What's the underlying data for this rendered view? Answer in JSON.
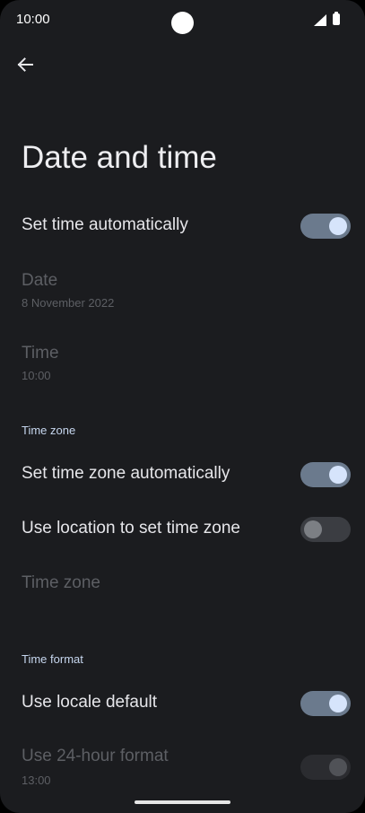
{
  "status_bar": {
    "time": "10:00"
  },
  "header": {
    "title": "Date and time"
  },
  "settings": {
    "set_time_automatically": {
      "label": "Set time automatically",
      "enabled": true
    },
    "date": {
      "label": "Date",
      "value": "8 November 2022"
    },
    "time": {
      "label": "Time",
      "value": "10:00"
    },
    "time_zone_section": {
      "label": "Time zone"
    },
    "set_time_zone_automatically": {
      "label": "Set time zone automatically",
      "enabled": true
    },
    "use_location": {
      "label": "Use location to set time zone",
      "enabled": false
    },
    "time_zone": {
      "label": "Time zone"
    },
    "time_format_section": {
      "label": "Time format"
    },
    "use_locale_default": {
      "label": "Use locale default",
      "enabled": true
    },
    "use_24_hour": {
      "label": "Use 24-hour format",
      "value": "13:00",
      "enabled": true
    }
  },
  "colors": {
    "background": "#1b1c1f",
    "accent": "#c6d6ee",
    "switch_on_track": "#6b7a8d",
    "switch_on_thumb": "#d6e4fb",
    "disabled_text": "#5d5f64"
  }
}
